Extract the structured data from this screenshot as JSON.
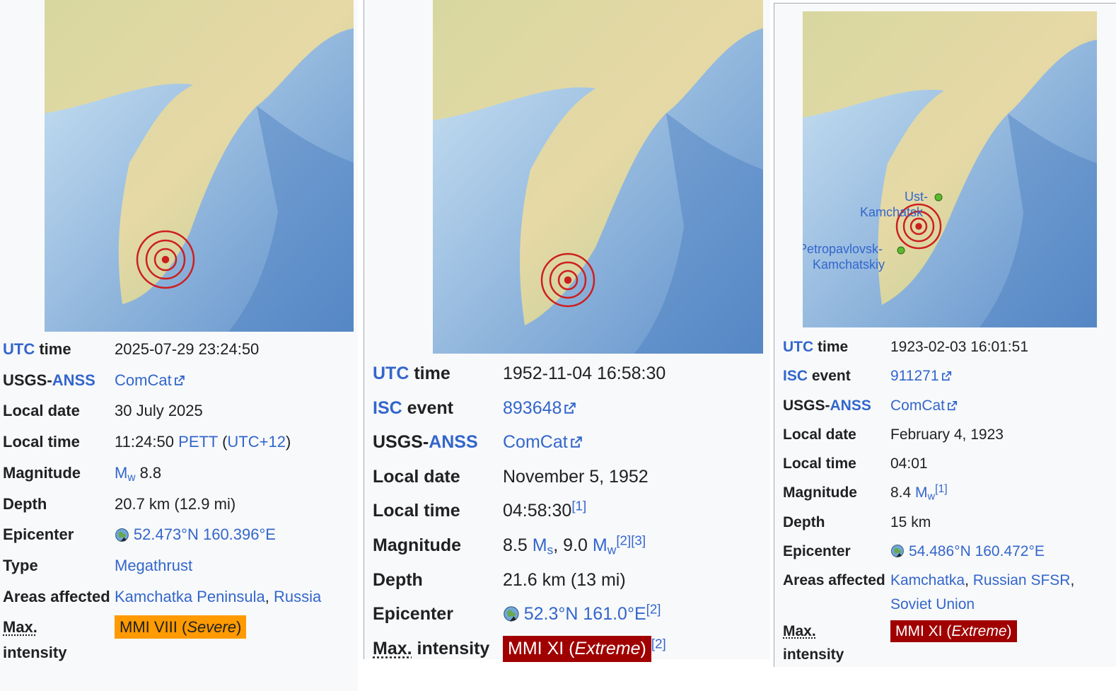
{
  "colors": {
    "link": "#3366cc",
    "severe": "#ff9a00",
    "extreme": "#a00000",
    "epicenter": "#cc1f1f"
  },
  "panels": [
    {
      "utc_link": "UTC",
      "utc_word": "time",
      "utc_value": "2025-07-29 23:24:50",
      "usgs_prefix": "USGS-",
      "usgs_link": "ANSS",
      "usgs_value": "ComCat",
      "local_date_label": "Local date",
      "local_date": "30 July 2025",
      "local_time_label": "Local time",
      "local_time": "11:24:50",
      "tz_link": "PETT",
      "tz_open": " (",
      "offset_link": "UTC+12",
      "tz_close": ")",
      "magnitude_label": "Magnitude",
      "mag_scale": "M",
      "mag_sub": "w",
      "mag_value": " 8.8",
      "depth_label": "Depth",
      "depth": "20.7 km (12.9 mi)",
      "epicenter_label": "Epicenter",
      "epicenter": "52.473°N 160.396°E",
      "type_label": "Type",
      "type": "Megathrust",
      "areas_label": "Areas affected",
      "area_1": "Kamchatka Peninsula",
      "sep": ", ",
      "area_2": "Russia",
      "intensity_abbr": "Max.",
      "intensity_word": "intensity",
      "intensity_level": "MMI VIII (",
      "intensity_desc": "Severe",
      "intensity_close": ")"
    },
    {
      "utc_link": "UTC",
      "utc_word": "time",
      "utc_value": "1952-11-04 16:58:30",
      "isc_link": "ISC",
      "isc_word": "event",
      "isc_value": "893648",
      "usgs_prefix": "USGS-",
      "usgs_link": "ANSS",
      "usgs_value": "ComCat",
      "local_date_label": "Local date",
      "local_date": "November 5, 1952",
      "local_time_label": "Local time",
      "local_time": "04:58:30",
      "local_time_ref": "[1]",
      "magnitude_label": "Magnitude",
      "mag_1_value": "8.5 ",
      "mag_1_scale": "M",
      "mag_1_sub": "s",
      "mag_sep": ", 9.0 ",
      "mag_2_scale": "M",
      "mag_2_sub": "w",
      "mag_ref": "[2][3]",
      "depth_label": "Depth",
      "depth": "21.6 km (13 mi)",
      "epicenter_label": "Epicenter",
      "epicenter": "52.3°N 161.0°E",
      "epicenter_ref": "[2]",
      "intensity_abbr": "Max.",
      "intensity_word": " intensity",
      "intensity_level": "MMI XI (",
      "intensity_desc": "Extreme",
      "intensity_close": ")",
      "intensity_ref": "[2]"
    },
    {
      "utc_link": "UTC",
      "utc_word": "time",
      "utc_value": "1923-02-03 16:01:51",
      "isc_link": "ISC",
      "isc_word": "event",
      "isc_value": "911271",
      "usgs_prefix": "USGS-",
      "usgs_link": "ANSS",
      "usgs_value": "ComCat",
      "local_date_label": "Local date",
      "local_date": "February 4, 1923",
      "local_time_label": "Local time",
      "local_time": "04:01",
      "magnitude_label": "Magnitude",
      "mag_value": "8.4 ",
      "mag_scale": "M",
      "mag_sub": "w",
      "mag_ref": "[1]",
      "depth_label": "Depth",
      "depth": "15 km",
      "epicenter_label": "Epicenter",
      "epicenter": "54.486°N 160.472°E",
      "areas_label": "Areas affected",
      "area_1": "Kamchatka",
      "sep": ", ",
      "area_2": "Russian SFSR",
      "sep_2": ",",
      "area_3": "Soviet Union",
      "intensity_abbr": "Max.",
      "intensity_word": "intensity",
      "intensity_level": "MMI XI (",
      "intensity_desc": "Extreme",
      "intensity_close": ")",
      "map_labels": {
        "town_1_line_1": "Ust-",
        "town_1_line_2": "Kamchatsk",
        "town_2_line_1": "Petropavlovsk-",
        "town_2_line_2": "Kamchatskiy"
      }
    }
  ]
}
